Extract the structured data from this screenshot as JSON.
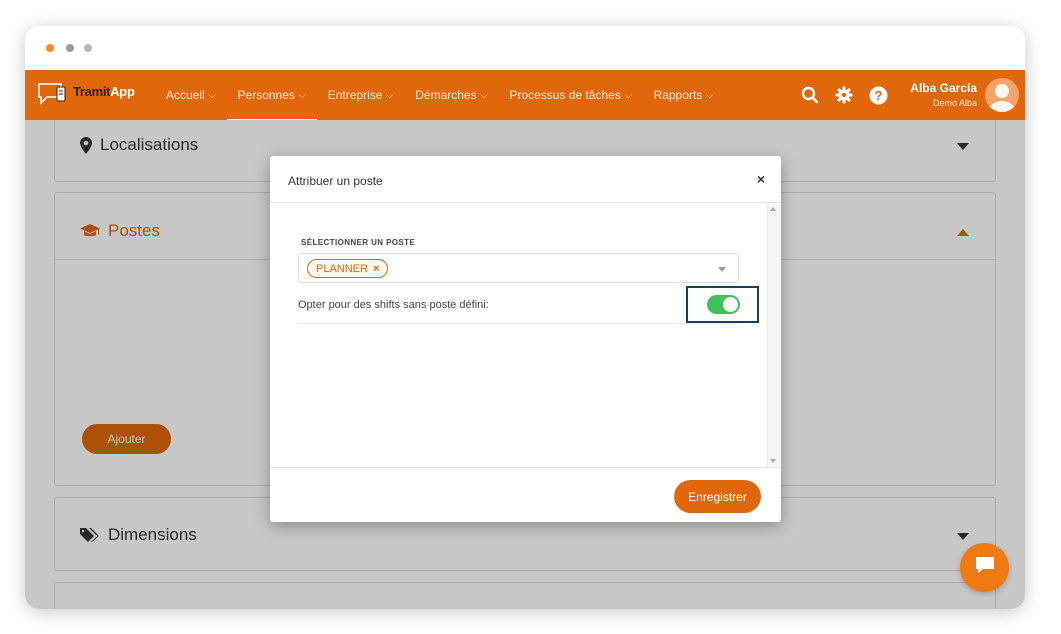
{
  "colors": {
    "brand": "#e0670c",
    "toggle_on": "#3fc25b",
    "highlight": "#1d3d5c"
  },
  "window": {
    "traffic_lights": [
      "orange",
      "gray",
      "gray"
    ]
  },
  "navbar": {
    "logo": {
      "part1": "Tramit",
      "part2": "App"
    },
    "items": [
      {
        "label": "Accueil",
        "active": false
      },
      {
        "label": "Personnes",
        "active": true
      },
      {
        "label": "Entreprise",
        "active": false
      },
      {
        "label": "Démarches",
        "active": false
      },
      {
        "label": "Processus de tâches",
        "active": false
      },
      {
        "label": "Rapports",
        "active": false
      }
    ],
    "icons": [
      "search-icon",
      "gear-icon",
      "help-icon"
    ],
    "user": {
      "name": "Alba García",
      "company": "Demo Alba"
    }
  },
  "panels": {
    "localisations": {
      "title": "Localisations",
      "icon": "map-marker-icon"
    },
    "postes": {
      "title": "Postes",
      "icon": "graduation-cap-icon",
      "add_button": "Ajouter"
    },
    "dimensions": {
      "title": "Dimensions",
      "icon": "tags-icon"
    }
  },
  "modal": {
    "title": "Attribuer un poste",
    "close": "×",
    "select_label": "SÉLECTIONNER UN POSTE",
    "selected_tags": [
      "PLANNER"
    ],
    "tag_remove": "×",
    "toggle_label": "Opter pour des shifts sans poste défini:",
    "toggle_on": true,
    "save_button": "Enregistrer"
  },
  "chat": {
    "icon": "chat-icon"
  }
}
